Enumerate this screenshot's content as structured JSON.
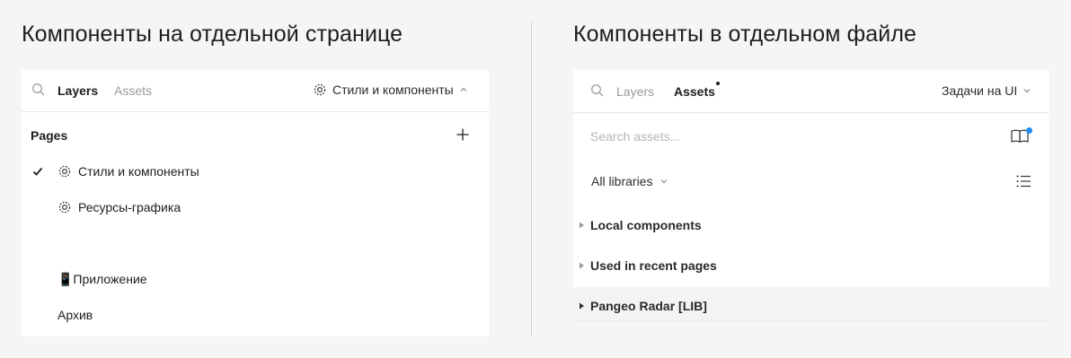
{
  "left": {
    "heading": "Компоненты на отдельной странице",
    "tabs": {
      "layers": "Layers",
      "assets": "Assets"
    },
    "current_page": "Стили и компоненты",
    "pages_label": "Pages",
    "pages": [
      {
        "label": "Стили и компоненты",
        "icon": "cog-icon",
        "checked": true
      },
      {
        "label": "Ресурсы-графика",
        "icon": "cog-icon",
        "checked": false
      },
      {
        "label": "📱Приложение",
        "icon": "",
        "checked": false
      },
      {
        "label": "Архив",
        "icon": "",
        "checked": false
      }
    ]
  },
  "right": {
    "heading": "Компоненты в отдельном файле",
    "tabs": {
      "layers": "Layers",
      "assets": "Assets"
    },
    "file_dropdown": "Задачи на UI",
    "search_placeholder": "Search assets...",
    "libraries_select": "All libraries",
    "libraries": [
      {
        "label": "Local components",
        "expanded": false
      },
      {
        "label": "Used in recent pages",
        "expanded": false
      },
      {
        "label": "Pangeo Radar [LIB]",
        "expanded": false,
        "highlighted": true
      }
    ]
  },
  "colors": {
    "background": "#f5f5f5",
    "panel": "#ffffff",
    "accent_blue": "#1e8cf0",
    "muted_text": "#9a9a9a"
  }
}
